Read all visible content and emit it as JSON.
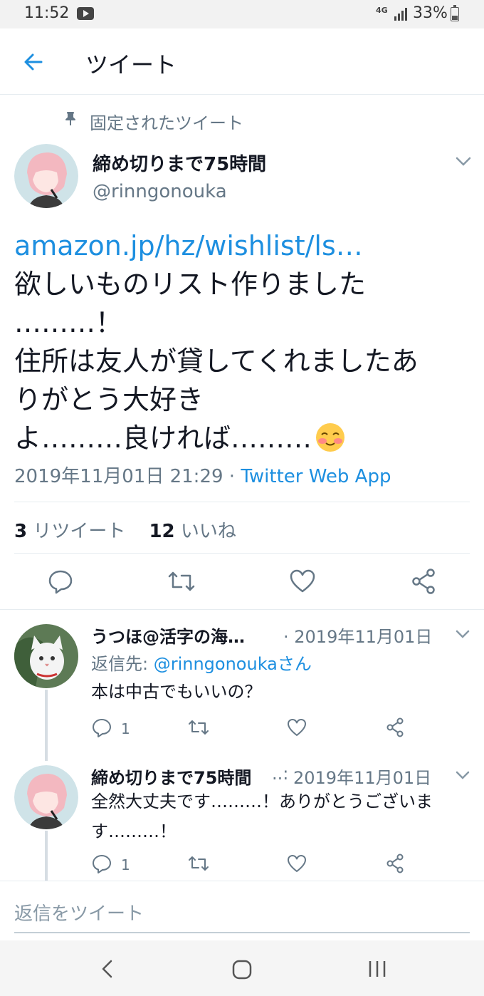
{
  "status_bar": {
    "time": "11:52",
    "network": "4G",
    "battery": "33%"
  },
  "header": {
    "title": "ツイート"
  },
  "pinned_label": "固定されたツイート",
  "main_tweet": {
    "name": "締め切りまで75時間",
    "handle": "@rinngonouka",
    "link": "amazon.jp/hz/wishlist/ls…",
    "lines": [
      "欲しいものリスト作りました",
      "………！",
      "住所は友人が貸してくれましたあ",
      "りがとう大好き",
      "よ………良ければ………"
    ],
    "emoji": "smiling-blush-emoji",
    "timestamp": "2019年11月01日 21:29 · ",
    "source": "Twitter Web App",
    "retweet_count": "3",
    "retweet_label": "リツイート",
    "like_count": "12",
    "like_label": "いいね"
  },
  "replies": [
    {
      "name": "うつほ@活字の海…",
      "date": "· 2019年11月01日",
      "reply_to_prefix": "返信先: ",
      "reply_to_handle": "@rinngonoukaさん",
      "text": "本は中古でもいいの？",
      "reply_count": "1"
    },
    {
      "name": "締め切りまで75時間",
      "name_suffix": "..:",
      "date": "2019年11月01日",
      "text": "全然大丈夫です………！ありがとうございます………！",
      "reply_count": "1"
    }
  ],
  "compose_placeholder": "返信をツイート",
  "colors": {
    "accent": "#1d8fe0",
    "secondary_text": "#657786",
    "divider": "#e6ecf0"
  }
}
